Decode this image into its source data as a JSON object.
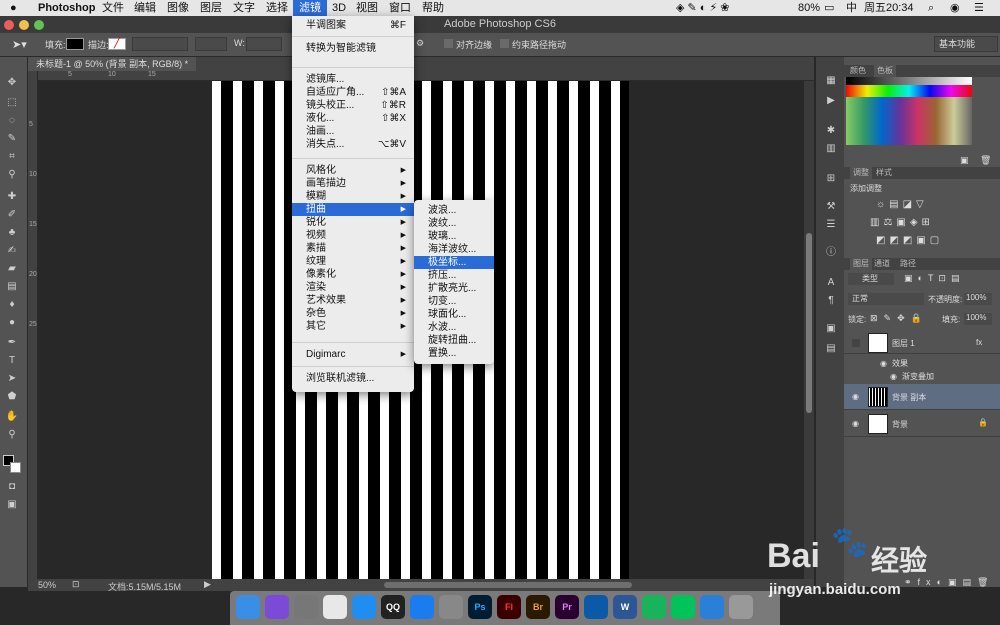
{
  "menubar": {
    "apple": "",
    "app": "Photoshop",
    "items": [
      "文件",
      "编辑",
      "图像",
      "图层",
      "文字",
      "选择",
      "滤镜",
      "3D",
      "视图",
      "窗口",
      "帮助"
    ],
    "battery": "80%",
    "clock": "周五20:34"
  },
  "window": {
    "title": "Adobe Photoshop CS6"
  },
  "options": {
    "fill_label": "填充:",
    "stroke_label": "描边:",
    "w_label": "W:",
    "align_edges": "对齐边缘",
    "constrain": "约束路径拖动",
    "workspace": "基本功能"
  },
  "document": {
    "tab": "未标题-1 @ 50% (背景 副本, RGB/8) *"
  },
  "ruler": {
    "h": [
      "5",
      "10",
      "15"
    ],
    "v": [
      "5",
      "10",
      "15",
      "20",
      "25"
    ]
  },
  "status": {
    "zoom": "50%",
    "doc": "文档:5.15M/5.15M"
  },
  "filter_menu": {
    "groups": [
      [
        {
          "label": "半调图案",
          "shortcut": "⌘F"
        }
      ],
      [
        {
          "label": "转换为智能滤镜",
          "shortcut": ""
        }
      ],
      [
        {
          "label": "滤镜库...",
          "shortcut": ""
        },
        {
          "label": "自适应广角...",
          "shortcut": "⇧⌘A"
        },
        {
          "label": "镜头校正...",
          "shortcut": "⇧⌘R"
        },
        {
          "label": "液化...",
          "shortcut": "⇧⌘X"
        },
        {
          "label": "油画...",
          "shortcut": ""
        },
        {
          "label": "消失点...",
          "shortcut": "⌥⌘V"
        }
      ],
      [
        {
          "label": "风格化",
          "arrow": true
        },
        {
          "label": "画笔描边",
          "arrow": true
        },
        {
          "label": "模糊",
          "arrow": true
        },
        {
          "label": "扭曲",
          "arrow": true,
          "highlight": true
        },
        {
          "label": "锐化",
          "arrow": true
        },
        {
          "label": "视频",
          "arrow": true
        },
        {
          "label": "素描",
          "arrow": true
        },
        {
          "label": "纹理",
          "arrow": true
        },
        {
          "label": "像素化",
          "arrow": true
        },
        {
          "label": "渲染",
          "arrow": true
        },
        {
          "label": "艺术效果",
          "arrow": true
        },
        {
          "label": "杂色",
          "arrow": true
        },
        {
          "label": "其它",
          "arrow": true
        }
      ],
      [
        {
          "label": "Digimarc",
          "arrow": true
        }
      ],
      [
        {
          "label": "浏览联机滤镜...",
          "shortcut": ""
        }
      ]
    ]
  },
  "distort_submenu": [
    "波浪...",
    "波纹...",
    "玻璃...",
    "海洋波纹...",
    "极坐标...",
    "挤压...",
    "扩散亮光...",
    "切变...",
    "球面化...",
    "水波...",
    "旋转扭曲...",
    "置换..."
  ],
  "distort_highlight": "极坐标...",
  "panels": {
    "color_tabs": [
      "颜色",
      "色板"
    ],
    "adjust_tabs": [
      "调整",
      "样式"
    ],
    "adjust_title": "添加调整",
    "layer_tabs": [
      "图层",
      "通道",
      "路径"
    ],
    "kind": "类型",
    "blend": "正常",
    "opacity_label": "不透明度:",
    "opacity": "100%",
    "lock_label": "锁定:",
    "fill_label": "填充:",
    "fill": "100%",
    "layers": [
      {
        "name": "图层 1",
        "fx": "fx"
      },
      {
        "name": "效果"
      },
      {
        "name": "渐变叠加"
      },
      {
        "name": "背景 副本"
      },
      {
        "name": "背景"
      }
    ]
  },
  "dock": [
    "Finder",
    "Siri",
    "Launchpad",
    "Chrome",
    "Safari",
    "QQ",
    "App Store",
    "系统偏好",
    "Ps",
    "Fl",
    "Br",
    "Pr",
    "QuickTime",
    "W",
    "WeChat",
    "iQIYI",
    "Xcode",
    "废纸篓"
  ],
  "watermark": {
    "brand": "Bai",
    "brand2": "经验",
    "url": "jingyan.baidu.com"
  },
  "colors": {
    "accent": "#2a6bd8",
    "panel": "#535353",
    "dark": "#424242"
  }
}
